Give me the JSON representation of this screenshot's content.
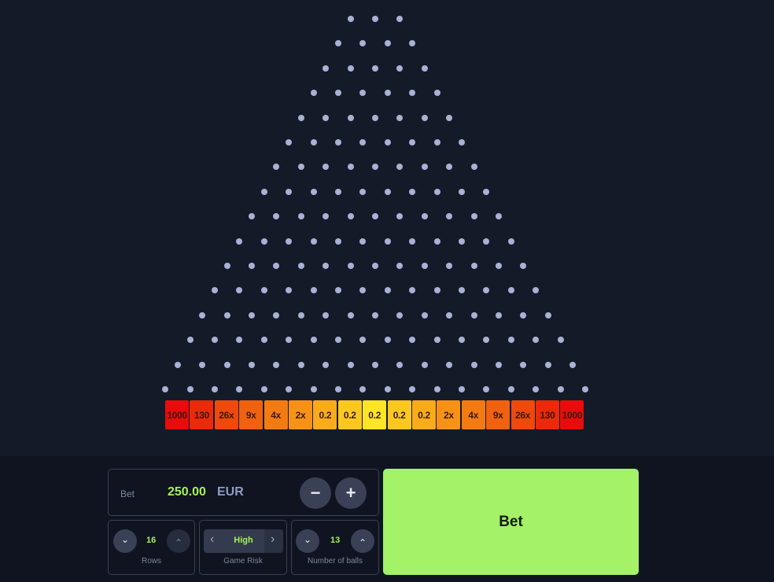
{
  "board": {
    "rows": 16,
    "peg_color": "#a9b1d6"
  },
  "multipliers": [
    {
      "label": "1000",
      "color": "#e80c0c"
    },
    {
      "label": "130",
      "color": "#ea2a0a"
    },
    {
      "label": "26x",
      "color": "#ee4a0c"
    },
    {
      "label": "9x",
      "color": "#f0620f"
    },
    {
      "label": "4x",
      "color": "#f47b12"
    },
    {
      "label": "2x",
      "color": "#f79217"
    },
    {
      "label": "0.2",
      "color": "#f9ab1c"
    },
    {
      "label": "0.2",
      "color": "#fbc822"
    },
    {
      "label": "0.2",
      "color": "#fde428"
    },
    {
      "label": "0.2",
      "color": "#fbc822"
    },
    {
      "label": "0.2",
      "color": "#f9ab1c"
    },
    {
      "label": "2x",
      "color": "#f79217"
    },
    {
      "label": "4x",
      "color": "#f47b12"
    },
    {
      "label": "9x",
      "color": "#f0620f"
    },
    {
      "label": "26x",
      "color": "#ee4a0c"
    },
    {
      "label": "130",
      "color": "#ea2a0a"
    },
    {
      "label": "1000",
      "color": "#e80c0c"
    }
  ],
  "bet": {
    "label": "Bet",
    "amount": "250.00",
    "currency": "EUR",
    "decrease_icon": "−",
    "increase_icon": "+"
  },
  "rows_control": {
    "value": "16",
    "label": "Rows",
    "down_icon": "⌄",
    "up_icon": "⌃"
  },
  "risk_control": {
    "value": "High",
    "label": "Game Risk",
    "prev_icon": "‹",
    "next_icon": "›"
  },
  "balls_control": {
    "value": "13",
    "label": "Number of balls",
    "down_icon": "⌄",
    "up_icon": "⌃"
  },
  "bet_button": {
    "label": "Bet",
    "color": "#a3f267"
  }
}
